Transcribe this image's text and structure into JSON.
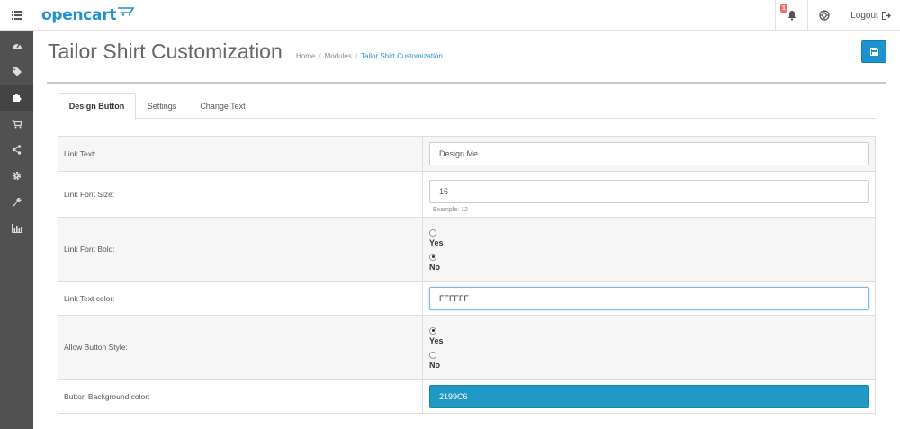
{
  "header": {
    "brand": "opencart",
    "notification_count": "1",
    "logout_label": "Logout"
  },
  "page": {
    "title": "Tailor Shirt Customization",
    "breadcrumb": [
      "Home",
      "Modules",
      "Tailor Shirt Customization"
    ]
  },
  "tabs": [
    {
      "label": "Design Button",
      "active": true
    },
    {
      "label": "Settings",
      "active": false
    },
    {
      "label": "Change Text",
      "active": false
    }
  ],
  "form": {
    "link_text": {
      "label": "Link Text:",
      "value": "Design Me"
    },
    "link_font_size": {
      "label": "Link Font Size:",
      "value": "16",
      "help": "Example: 12"
    },
    "link_font_bold": {
      "label": "Link Font Bold:",
      "options": [
        "Yes",
        "No"
      ],
      "selected": "No"
    },
    "link_text_color": {
      "label": "Link Text color:",
      "value": "FFFFFF"
    },
    "allow_button_style": {
      "label": "Allow Button Style:",
      "options": [
        "Yes",
        "No"
      ],
      "selected": "Yes"
    },
    "button_bg_color": {
      "label": "Button Background color:",
      "value": "2199C6"
    }
  },
  "colors": {
    "brand": "#1e91cf",
    "sidebar": "#515151",
    "button_bg_swatch": "#2199c6"
  },
  "sidebar_icons": [
    "dashboard-icon",
    "tags-icon",
    "puzzle-icon",
    "cart-icon",
    "share-icon",
    "cog-icon",
    "wrench-icon",
    "bar-chart-icon"
  ]
}
